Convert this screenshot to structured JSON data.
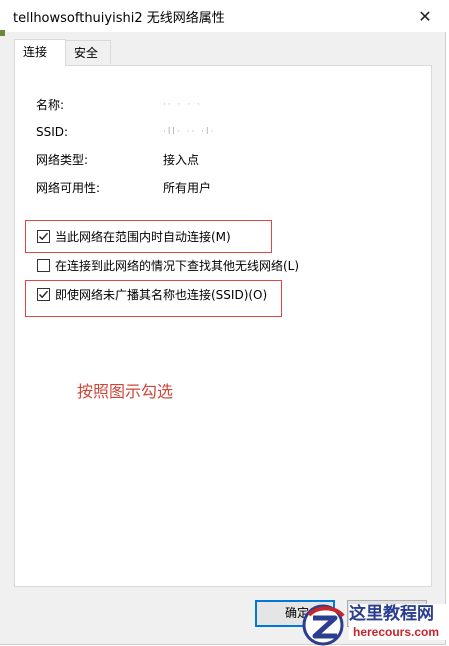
{
  "window": {
    "title": "tellhowsofthuiyishi2 无线网络属性",
    "close_glyph": "✕"
  },
  "tabs": [
    {
      "label": "连接",
      "active": true
    },
    {
      "label": "安全",
      "active": false
    }
  ],
  "properties": [
    {
      "label": "名称:",
      "value": "·· ·  ·  ·"
    },
    {
      "label": "SSID:",
      "value": "·ll·  ·· ·l·"
    },
    {
      "label": "网络类型:",
      "value": "接入点"
    },
    {
      "label": "网络可用性:",
      "value": "所有用户"
    }
  ],
  "options": [
    {
      "label": "当此网络在范围内时自动连接(M)",
      "checked": true
    },
    {
      "label": "在连接到此网络的情况下查找其他无线网络(L)",
      "checked": false
    },
    {
      "label": "即使网络未广播其名称也连接(SSID)(O)",
      "checked": true
    }
  ],
  "annotation": {
    "text": "按照图示勾选",
    "color": "#d0463a"
  },
  "buttons": {
    "ok_label": "确定",
    "cancel_label": ""
  },
  "watermark": {
    "name_cn": "这里教程网",
    "domain": "herecours.com"
  },
  "colors": {
    "accent": "#0078d7",
    "annotation_border": "#e04848"
  }
}
